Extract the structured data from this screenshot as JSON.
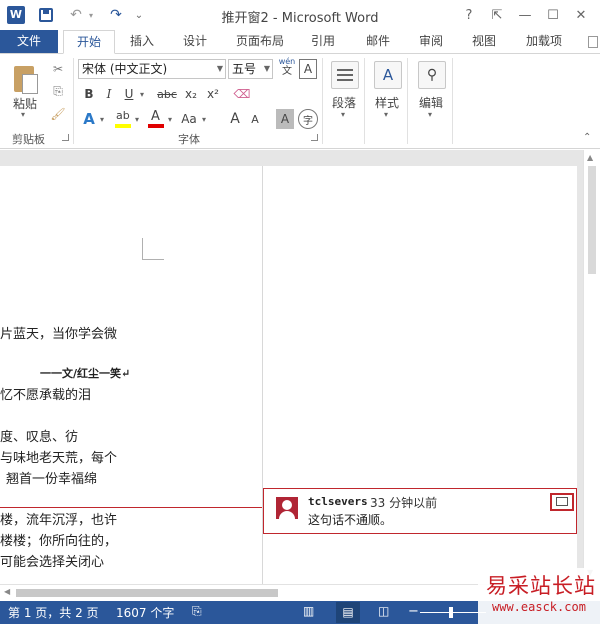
{
  "window": {
    "title": "推开窗2 - Microsoft Word",
    "help": "?",
    "restore_ribbon": "⇱",
    "minimize": "—",
    "maximize": "☐",
    "close": "✕"
  },
  "quick_access": {
    "undo": "↶",
    "redo": "↷",
    "more": "⌄"
  },
  "tabs": [
    {
      "label": "文件"
    },
    {
      "label": "开始"
    },
    {
      "label": "插入"
    },
    {
      "label": "设计"
    },
    {
      "label": "页面布局"
    },
    {
      "label": "引用"
    },
    {
      "label": "邮件"
    },
    {
      "label": "审阅"
    },
    {
      "label": "视图"
    },
    {
      "label": "加载项"
    }
  ],
  "ribbon": {
    "clipboard": {
      "paste": "粘贴",
      "group": "剪贴板"
    },
    "font": {
      "name": "宋体 (中文正文)",
      "size": "五号",
      "phonetic": "wén",
      "border_char": "A",
      "bold": "B",
      "italic": "I",
      "underline": "U",
      "strike": "abc",
      "sub": "x₂",
      "sup": "x²",
      "grow": "A",
      "shrink": "A",
      "case": "Aa",
      "shade": "A",
      "enclose": "字",
      "color_a": "A",
      "group": "字体"
    },
    "paragraph": {
      "label": "段落"
    },
    "styles": {
      "label": "样式"
    },
    "editing": {
      "label": "编辑"
    }
  },
  "document": {
    "lines": [
      "片蓝天，当你学会微",
      "一一文/红尘一笑↵",
      "忆不愿承载的泪",
      "度、叹息、彷",
      "与味地老天荒，每个",
      "翘首一份幸福绵",
      "楼，流年沉浮，也许",
      "楼楼；你所向往的，",
      "可能会选择关闭心"
    ]
  },
  "comment": {
    "author": "tclsevers",
    "time": "33 分钟以前",
    "text": "这句话不通顺。"
  },
  "status": {
    "page": "第 1 页，共 2 页",
    "words": "1607 个字"
  },
  "watermark": {
    "brand": "易采站长站",
    "url": "www.easck.com"
  },
  "colors": {
    "accent": "#2b579a",
    "comment_border": "#c0272d",
    "highlight": "#ffff00",
    "font_red": "#e00000"
  }
}
